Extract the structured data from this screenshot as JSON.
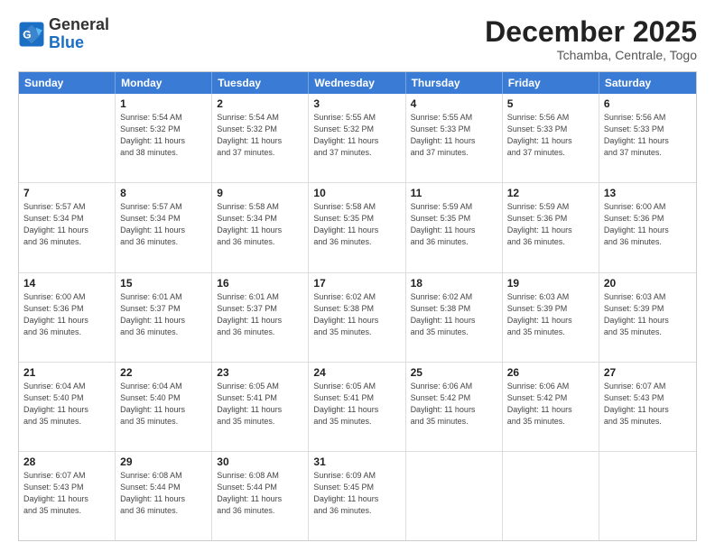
{
  "logo": {
    "line1": "General",
    "line2": "Blue"
  },
  "title": "December 2025",
  "location": "Tchamba, Centrale, Togo",
  "days_header": [
    "Sunday",
    "Monday",
    "Tuesday",
    "Wednesday",
    "Thursday",
    "Friday",
    "Saturday"
  ],
  "weeks": [
    [
      {
        "num": "",
        "info": ""
      },
      {
        "num": "1",
        "info": "Sunrise: 5:54 AM\nSunset: 5:32 PM\nDaylight: 11 hours\nand 38 minutes."
      },
      {
        "num": "2",
        "info": "Sunrise: 5:54 AM\nSunset: 5:32 PM\nDaylight: 11 hours\nand 37 minutes."
      },
      {
        "num": "3",
        "info": "Sunrise: 5:55 AM\nSunset: 5:32 PM\nDaylight: 11 hours\nand 37 minutes."
      },
      {
        "num": "4",
        "info": "Sunrise: 5:55 AM\nSunset: 5:33 PM\nDaylight: 11 hours\nand 37 minutes."
      },
      {
        "num": "5",
        "info": "Sunrise: 5:56 AM\nSunset: 5:33 PM\nDaylight: 11 hours\nand 37 minutes."
      },
      {
        "num": "6",
        "info": "Sunrise: 5:56 AM\nSunset: 5:33 PM\nDaylight: 11 hours\nand 37 minutes."
      }
    ],
    [
      {
        "num": "7",
        "info": "Sunrise: 5:57 AM\nSunset: 5:34 PM\nDaylight: 11 hours\nand 36 minutes."
      },
      {
        "num": "8",
        "info": "Sunrise: 5:57 AM\nSunset: 5:34 PM\nDaylight: 11 hours\nand 36 minutes."
      },
      {
        "num": "9",
        "info": "Sunrise: 5:58 AM\nSunset: 5:34 PM\nDaylight: 11 hours\nand 36 minutes."
      },
      {
        "num": "10",
        "info": "Sunrise: 5:58 AM\nSunset: 5:35 PM\nDaylight: 11 hours\nand 36 minutes."
      },
      {
        "num": "11",
        "info": "Sunrise: 5:59 AM\nSunset: 5:35 PM\nDaylight: 11 hours\nand 36 minutes."
      },
      {
        "num": "12",
        "info": "Sunrise: 5:59 AM\nSunset: 5:36 PM\nDaylight: 11 hours\nand 36 minutes."
      },
      {
        "num": "13",
        "info": "Sunrise: 6:00 AM\nSunset: 5:36 PM\nDaylight: 11 hours\nand 36 minutes."
      }
    ],
    [
      {
        "num": "14",
        "info": "Sunrise: 6:00 AM\nSunset: 5:36 PM\nDaylight: 11 hours\nand 36 minutes."
      },
      {
        "num": "15",
        "info": "Sunrise: 6:01 AM\nSunset: 5:37 PM\nDaylight: 11 hours\nand 36 minutes."
      },
      {
        "num": "16",
        "info": "Sunrise: 6:01 AM\nSunset: 5:37 PM\nDaylight: 11 hours\nand 36 minutes."
      },
      {
        "num": "17",
        "info": "Sunrise: 6:02 AM\nSunset: 5:38 PM\nDaylight: 11 hours\nand 35 minutes."
      },
      {
        "num": "18",
        "info": "Sunrise: 6:02 AM\nSunset: 5:38 PM\nDaylight: 11 hours\nand 35 minutes."
      },
      {
        "num": "19",
        "info": "Sunrise: 6:03 AM\nSunset: 5:39 PM\nDaylight: 11 hours\nand 35 minutes."
      },
      {
        "num": "20",
        "info": "Sunrise: 6:03 AM\nSunset: 5:39 PM\nDaylight: 11 hours\nand 35 minutes."
      }
    ],
    [
      {
        "num": "21",
        "info": "Sunrise: 6:04 AM\nSunset: 5:40 PM\nDaylight: 11 hours\nand 35 minutes."
      },
      {
        "num": "22",
        "info": "Sunrise: 6:04 AM\nSunset: 5:40 PM\nDaylight: 11 hours\nand 35 minutes."
      },
      {
        "num": "23",
        "info": "Sunrise: 6:05 AM\nSunset: 5:41 PM\nDaylight: 11 hours\nand 35 minutes."
      },
      {
        "num": "24",
        "info": "Sunrise: 6:05 AM\nSunset: 5:41 PM\nDaylight: 11 hours\nand 35 minutes."
      },
      {
        "num": "25",
        "info": "Sunrise: 6:06 AM\nSunset: 5:42 PM\nDaylight: 11 hours\nand 35 minutes."
      },
      {
        "num": "26",
        "info": "Sunrise: 6:06 AM\nSunset: 5:42 PM\nDaylight: 11 hours\nand 35 minutes."
      },
      {
        "num": "27",
        "info": "Sunrise: 6:07 AM\nSunset: 5:43 PM\nDaylight: 11 hours\nand 35 minutes."
      }
    ],
    [
      {
        "num": "28",
        "info": "Sunrise: 6:07 AM\nSunset: 5:43 PM\nDaylight: 11 hours\nand 35 minutes."
      },
      {
        "num": "29",
        "info": "Sunrise: 6:08 AM\nSunset: 5:44 PM\nDaylight: 11 hours\nand 36 minutes."
      },
      {
        "num": "30",
        "info": "Sunrise: 6:08 AM\nSunset: 5:44 PM\nDaylight: 11 hours\nand 36 minutes."
      },
      {
        "num": "31",
        "info": "Sunrise: 6:09 AM\nSunset: 5:45 PM\nDaylight: 11 hours\nand 36 minutes."
      },
      {
        "num": "",
        "info": ""
      },
      {
        "num": "",
        "info": ""
      },
      {
        "num": "",
        "info": ""
      }
    ]
  ]
}
